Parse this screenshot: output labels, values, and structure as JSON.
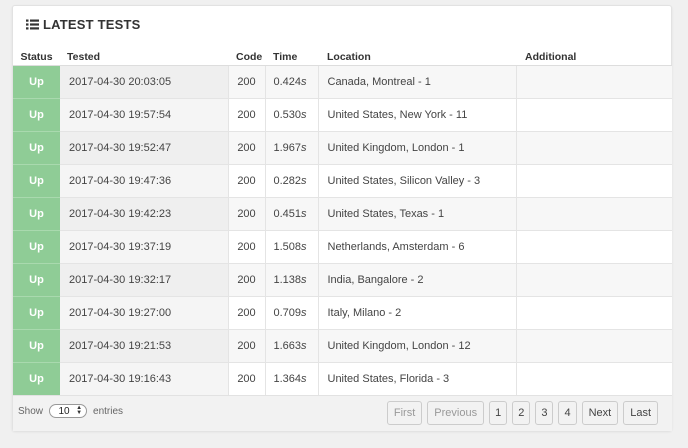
{
  "panel": {
    "title": "LATEST TESTS",
    "title_icon": "list-icon"
  },
  "table": {
    "headers": {
      "status": "Status",
      "tested": "Tested",
      "code": "Code",
      "time": "Time",
      "location": "Location",
      "additional": "Additional"
    },
    "rows": [
      {
        "status": "Up",
        "tested": "2017-04-30 20:03:05",
        "code": "200",
        "time": "0.424",
        "unit": "s",
        "location": "Canada, Montreal - 1",
        "additional": ""
      },
      {
        "status": "Up",
        "tested": "2017-04-30 19:57:54",
        "code": "200",
        "time": "0.530",
        "unit": "s",
        "location": "United States, New York - 11",
        "additional": ""
      },
      {
        "status": "Up",
        "tested": "2017-04-30 19:52:47",
        "code": "200",
        "time": "1.967",
        "unit": "s",
        "location": "United Kingdom, London - 1",
        "additional": ""
      },
      {
        "status": "Up",
        "tested": "2017-04-30 19:47:36",
        "code": "200",
        "time": "0.282",
        "unit": "s",
        "location": "United States, Silicon Valley - 3",
        "additional": ""
      },
      {
        "status": "Up",
        "tested": "2017-04-30 19:42:23",
        "code": "200",
        "time": "0.451",
        "unit": "s",
        "location": "United States, Texas - 1",
        "additional": ""
      },
      {
        "status": "Up",
        "tested": "2017-04-30 19:37:19",
        "code": "200",
        "time": "1.508",
        "unit": "s",
        "location": "Netherlands, Amsterdam - 6",
        "additional": ""
      },
      {
        "status": "Up",
        "tested": "2017-04-30 19:32:17",
        "code": "200",
        "time": "1.138",
        "unit": "s",
        "location": "India, Bangalore - 2",
        "additional": ""
      },
      {
        "status": "Up",
        "tested": "2017-04-30 19:27:00",
        "code": "200",
        "time": "0.709",
        "unit": "s",
        "location": "Italy, Milano - 2",
        "additional": ""
      },
      {
        "status": "Up",
        "tested": "2017-04-30 19:21:53",
        "code": "200",
        "time": "1.663",
        "unit": "s",
        "location": "United Kingdom, London - 12",
        "additional": ""
      },
      {
        "status": "Up",
        "tested": "2017-04-30 19:16:43",
        "code": "200",
        "time": "1.364",
        "unit": "s",
        "location": "United States, Florida - 3",
        "additional": ""
      }
    ]
  },
  "footer": {
    "show_label": "Show",
    "entries_value": "10",
    "entries_label": "entries",
    "pagination": {
      "first": "First",
      "previous": "Previous",
      "pages": [
        "1",
        "2",
        "3",
        "4"
      ],
      "next": "Next",
      "last": "Last"
    }
  },
  "colors": {
    "status_up": "#8fcc96",
    "background": "#f0f0f0"
  }
}
